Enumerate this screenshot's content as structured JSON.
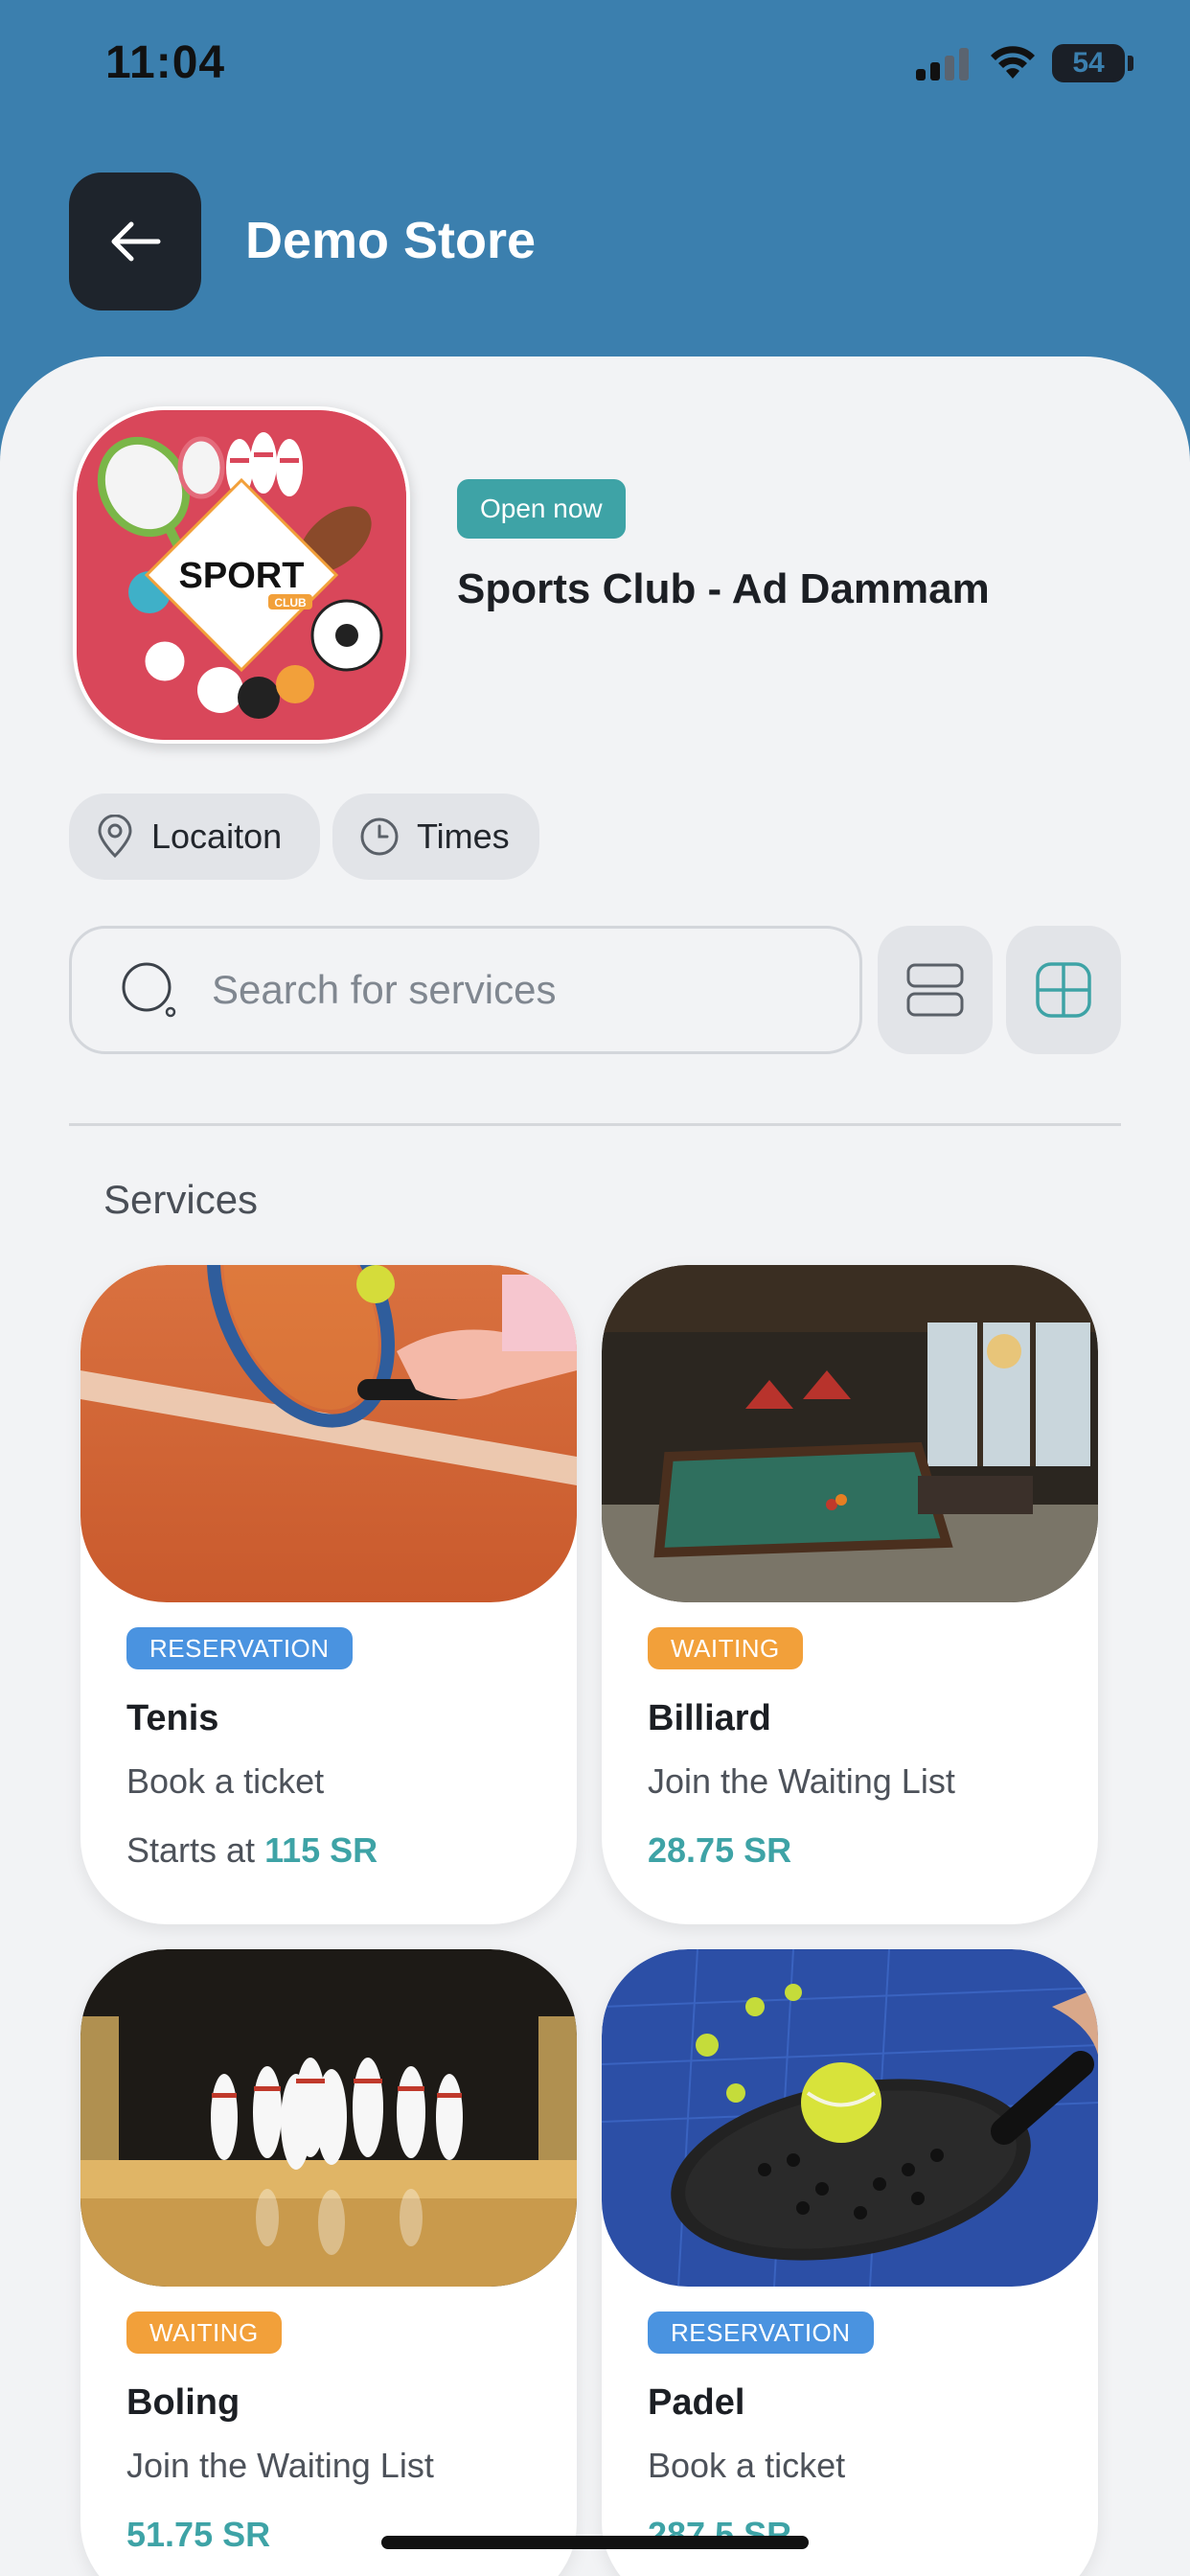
{
  "status_bar": {
    "time": "11:04",
    "battery": "54"
  },
  "header": {
    "title": "Demo Store"
  },
  "store": {
    "logo_text": "SPORT",
    "logo_subtext": "CLUB",
    "open_status": "Open now",
    "name": "Sports Club - Ad Dammam"
  },
  "chips": {
    "location": "Locaiton",
    "times": "Times"
  },
  "search": {
    "placeholder": "Search for services"
  },
  "section": {
    "title": "Services"
  },
  "services": [
    {
      "badge": "RESERVATION",
      "title": "Tenis",
      "subtitle": "Book a ticket",
      "price_prefix": "Starts at ",
      "price": "115 SR"
    },
    {
      "badge": "WAITING",
      "title": "Billiard",
      "subtitle": "Join the Waiting List",
      "price_prefix": "",
      "price": "28.75 SR"
    },
    {
      "badge": "WAITING",
      "title": "Boling",
      "subtitle": "Join the Waiting List",
      "price_prefix": "",
      "price": "51.75 SR"
    },
    {
      "badge": "RESERVATION",
      "title": "Padel",
      "subtitle": "Book a ticket",
      "price_prefix": "",
      "price": "287.5 SR"
    }
  ],
  "colors": {
    "header_bg": "#3b7fae",
    "accent_teal": "#3ea3a6",
    "reservation_blue": "#4a93e0",
    "waiting_orange": "#f2a03a"
  }
}
